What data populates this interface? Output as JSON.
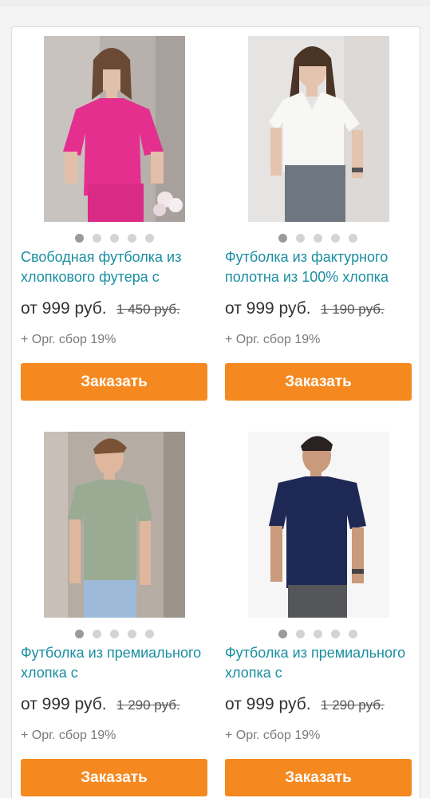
{
  "products": [
    {
      "title": "Свободная футболка из хлопкового футера с",
      "price": "от 999 руб.",
      "old_price": "1 450 руб.",
      "fee": "+ Орг. сбор 19%",
      "button": "Заказать",
      "image": "woman-pink-tshirt-photo",
      "dots": 5,
      "active_dot": 0
    },
    {
      "title": "Футболка из фактурного полотна из 100% хлопка",
      "price": "от 999 руб.",
      "old_price": "1 190 руб.",
      "fee": "+ Орг. сбор 19%",
      "button": "Заказать",
      "image": "woman-white-tshirt-photo",
      "dots": 5,
      "active_dot": 0
    },
    {
      "title": "Футболка из премиального хлопка с",
      "price": "от 999 руб.",
      "old_price": "1 290 руб.",
      "fee": "+ Орг. сбор 19%",
      "button": "Заказать",
      "image": "man-sage-tshirt-photo",
      "dots": 5,
      "active_dot": 0
    },
    {
      "title": "Футболка из премиального хлопка с",
      "price": "от 999 руб.",
      "old_price": "1 290 руб.",
      "fee": "+ Орг. сбор 19%",
      "button": "Заказать",
      "image": "man-navy-tshirt-photo",
      "dots": 5,
      "active_dot": 0
    }
  ],
  "colors": {
    "title": "#1a8ea1",
    "button": "#f5891f",
    "price": "#333333",
    "fee": "#7a7a7a"
  }
}
